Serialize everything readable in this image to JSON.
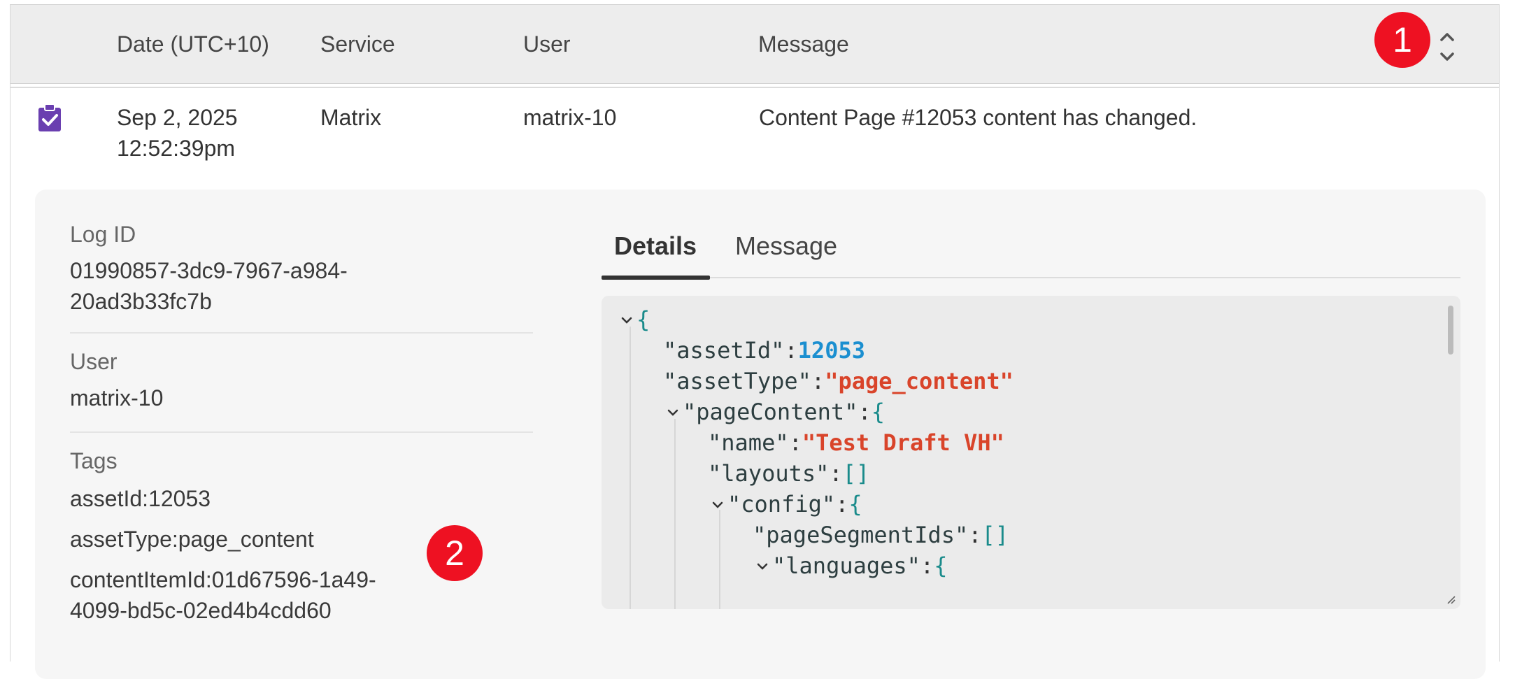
{
  "table": {
    "columns": [
      "Date (UTC+10)",
      "Service",
      "User",
      "Message"
    ],
    "row": {
      "date_line1": "Sep 2, 2025",
      "date_line2": "12:52:39pm",
      "service": "Matrix",
      "user": "matrix-10",
      "message": "Content Page #12053 content has changed."
    }
  },
  "annotations": {
    "badge1": "1",
    "badge2": "2"
  },
  "details": {
    "log_id_label": "Log ID",
    "log_id_line1": "01990857-3dc9-7967-a984-",
    "log_id_line2": "20ad3b33fc7b",
    "user_label": "User",
    "user_value": "matrix-10",
    "tags_label": "Tags",
    "tags": [
      "assetId:12053",
      "assetType:page_content",
      "contentItemId:01d67596-1a49-",
      "4099-bd5c-02ed4b4cdd60"
    ],
    "tabs": [
      "Details",
      "Message"
    ],
    "active_tab": "Details"
  },
  "json_view": {
    "open_brace": "{",
    "asset_id_key": "\"assetId\"",
    "asset_id_value": "12053",
    "asset_type_key": "\"assetType\"",
    "asset_type_value": "\"page_content\"",
    "page_content_key": "\"pageContent\"",
    "name_key": "\"name\"",
    "name_value": "\"Test Draft VH\"",
    "layouts_key": "\"layouts\"",
    "empty_array": "[]",
    "config_key": "\"config\"",
    "page_segment_ids_key": "\"pageSegmentIds\"",
    "languages_key": "\"languages\"",
    "colon": ":"
  },
  "colors": {
    "accent_purple": "#6a3fb0",
    "badge_red": "#ee1122",
    "string_red": "#d9442a",
    "number_blue": "#1b8fd0",
    "brace_teal": "#1a8b8b"
  }
}
